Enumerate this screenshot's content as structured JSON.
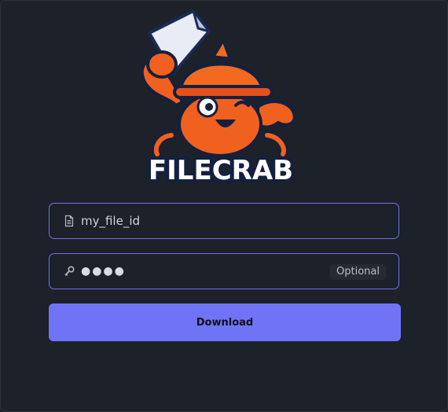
{
  "app": {
    "logo_text": "FILECRAB"
  },
  "form": {
    "file_id": {
      "value": "",
      "placeholder": "my_file_id",
      "icon": "file-icon"
    },
    "password": {
      "masked_value": "●●●●",
      "optional_label": "Optional",
      "icon": "key-icon"
    },
    "download_label": "Download"
  },
  "colors": {
    "background": "#1d2129",
    "accent": "#6f74f7",
    "field_border": "#6d72f2",
    "text": "#d9dce2",
    "crab_orange": "#f0601e"
  }
}
